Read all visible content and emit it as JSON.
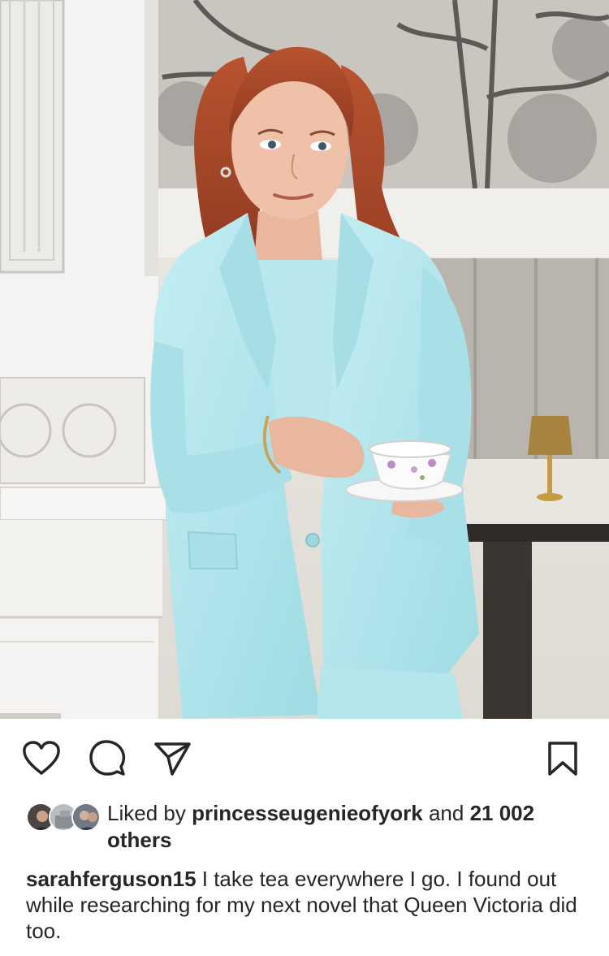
{
  "post": {
    "image_alt": "Woman in a light blue suit holding a teacup and saucer",
    "colors": {
      "suit": "#aee3ea",
      "hair": "#a8452a",
      "text": "#262626",
      "background": "#ffffff"
    }
  },
  "actions": {
    "like_icon": "heart-icon",
    "comment_icon": "comment-icon",
    "share_icon": "send-icon",
    "save_icon": "bookmark-icon"
  },
  "likes": {
    "prefix": "Liked by ",
    "liker": "princesseugenieofyork",
    "connector": " and ",
    "count": "21 002",
    "suffix": "others"
  },
  "caption": {
    "username": "sarahferguson15",
    "text": "I take tea everywhere I go. I found out while researching for my next novel that Queen Victoria did too."
  }
}
